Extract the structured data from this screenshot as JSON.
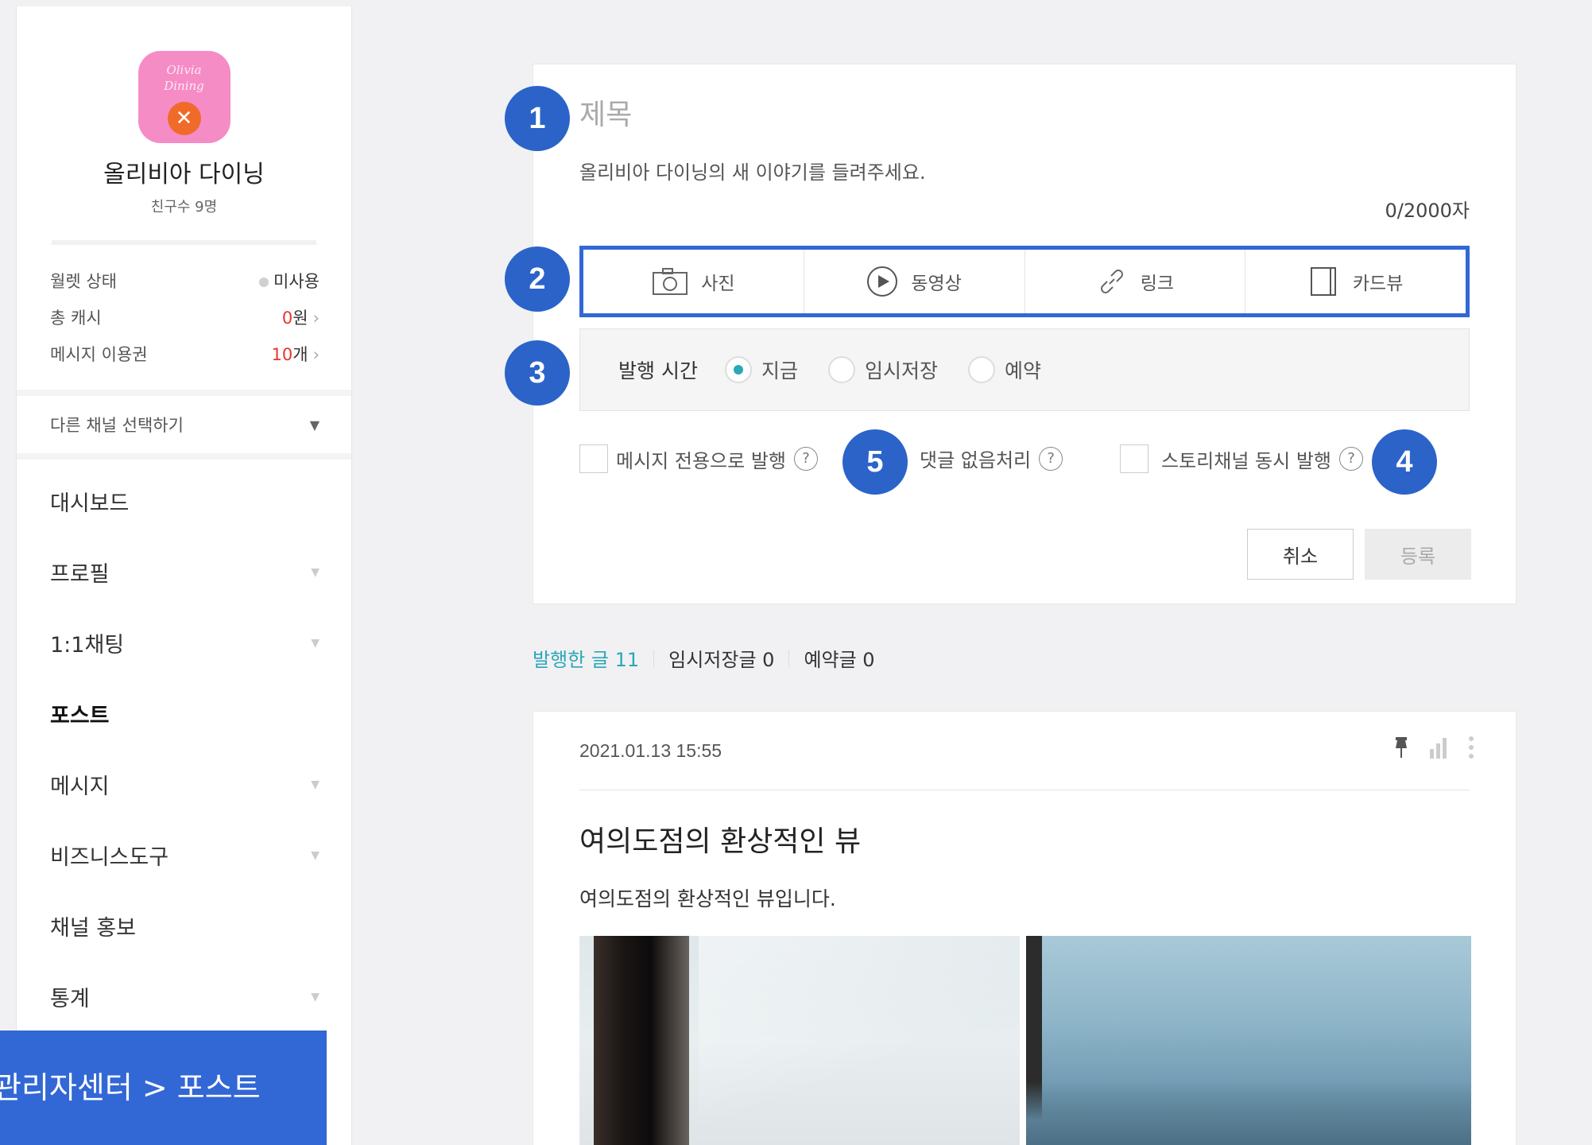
{
  "sidebar": {
    "logo_text": "Olivia\nDining",
    "channel_name": "올리비아 다이닝",
    "friends": "친구수 9명",
    "stats": [
      {
        "label": "월렛 상태",
        "value": "미사용"
      },
      {
        "label": "총 캐시",
        "value_num": "0",
        "value_unit": "원"
      },
      {
        "label": "메시지 이용권",
        "value_num": "10",
        "value_unit": "개"
      }
    ],
    "channel_select": "다른 채널 선택하기",
    "nav": [
      {
        "label": "대시보드"
      },
      {
        "label": "프로필"
      },
      {
        "label": "1:1채팅"
      },
      {
        "label": "포스트"
      },
      {
        "label": "메시지"
      },
      {
        "label": "비즈니스도구"
      },
      {
        "label": "채널 홍보"
      },
      {
        "label": "통계"
      }
    ]
  },
  "bottom_label": "관리자센터 > 포스트",
  "editor": {
    "title_placeholder": "제목",
    "body_placeholder": "올리비아 다이닝의 새 이야기를 들려주세요.",
    "counter": "0/2000자",
    "media": [
      {
        "label": "사진",
        "icon": "camera-icon"
      },
      {
        "label": "동영상",
        "icon": "play-icon"
      },
      {
        "label": "링크",
        "icon": "link-icon"
      },
      {
        "label": "카드뷰",
        "icon": "cardview-icon"
      }
    ],
    "publish_time_label": "발행 시간",
    "publish_options": [
      "지금",
      "임시저장",
      "예약"
    ],
    "publish_selected": "지금",
    "checkboxes": [
      "메시지 전용으로 발행",
      "댓글 없음처리",
      "스토리채널 동시 발행"
    ],
    "cancel": "취소",
    "submit": "등록"
  },
  "badges": [
    "1",
    "2",
    "3",
    "4",
    "5"
  ],
  "post_tabs": [
    "발행한 글 11",
    "임시저장글 0",
    "예약글 0"
  ],
  "post": {
    "date": "2021.01.13 15:55",
    "title": "여의도점의 환상적인 뷰",
    "body": "여의도점의 환상적인 뷰입니다."
  },
  "colors": {
    "accent": "#3267d6",
    "teal": "#2aa7b8",
    "red": "#e4372c"
  }
}
